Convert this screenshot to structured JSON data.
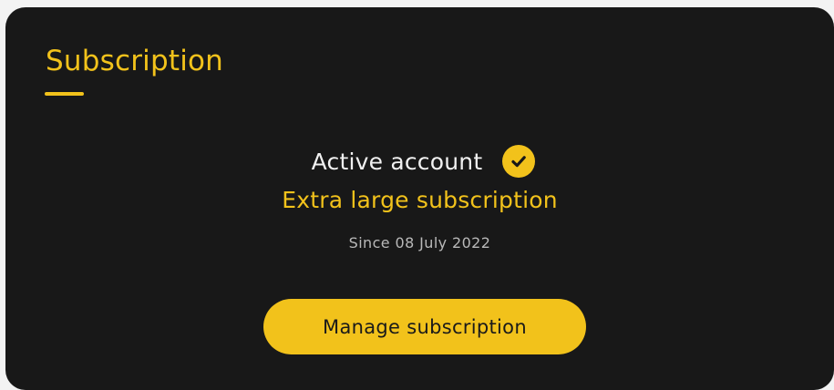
{
  "section": {
    "title": "Subscription"
  },
  "status": {
    "label": "Active account",
    "icon": "check-circle-icon"
  },
  "plan": {
    "name": "Extra large subscription",
    "since": "Since 08 July 2022"
  },
  "actions": {
    "manage_label": "Manage subscription"
  },
  "colors": {
    "accent": "#f2c21b",
    "card_background": "#181818",
    "primary_text": "#f1f1f1",
    "secondary_text": "#b9b9b9"
  }
}
